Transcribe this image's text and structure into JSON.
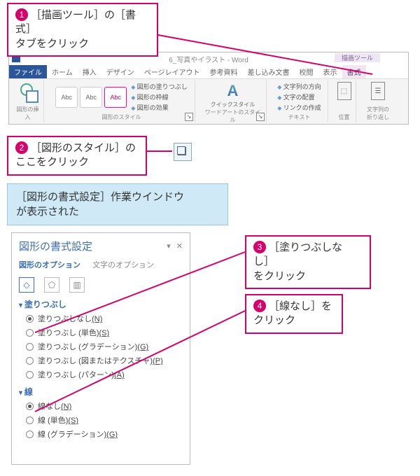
{
  "callouts": {
    "c1": {
      "num": "1",
      "text_a": "［描画ツール］の［書式］",
      "text_b": "タブをクリック"
    },
    "c2": {
      "num": "2",
      "text_a": "［図形のスタイル］の",
      "text_b": "ここをクリック"
    },
    "c3": {
      "num": "3",
      "text_a": "［塗りつぶしなし］",
      "text_b": "をクリック"
    },
    "c4": {
      "num": "4",
      "text_a": "［線なし］を",
      "text_b": "クリック"
    }
  },
  "note": {
    "line1": "［図形の書式設定］作業ウインドウ",
    "line2": "が表示された"
  },
  "ribbon": {
    "doc_title": "6_写真やイラスト - Word",
    "drawing_tools": "描画ツール",
    "tabs": {
      "file": "ファイル",
      "home": "ホーム",
      "insert": "挿入",
      "design": "デザイン",
      "layout": "ページレイアウト",
      "references": "参考資料",
      "mailings": "差し込み文書",
      "review": "校閲",
      "view": "表示",
      "format": "書式"
    },
    "groups": {
      "insert_shapes": "図形の挿入",
      "shape_styles": "図形のスタイル",
      "wordart_styles": "ワードアートのスタイル",
      "text": "テキスト",
      "arrange1": "位置",
      "arrange2": "文字列の折り返し"
    },
    "shape_fill": "図形の塗りつぶし",
    "shape_outline": "図形の枠線",
    "shape_effects": "図形の効果",
    "quick_styles": "クイックスタイル",
    "text_direction": "文字列の方向",
    "align_text": "文字の配置",
    "create_link": "リンクの作成",
    "abc": "Abc"
  },
  "pane": {
    "title": "図形の書式設定",
    "dropdown": "▾",
    "close": "✕",
    "shape_options": "図形のオプション",
    "text_options": "文字のオプション",
    "section_fill": "塗りつぶし",
    "fill": {
      "none": {
        "label": "塗りつぶしなし",
        "accel": "(N)"
      },
      "solid": {
        "label": "塗りつぶし (単色)",
        "accel": "(S)"
      },
      "gradient": {
        "label": "塗りつぶし (グラデーション)",
        "accel": "(G)"
      },
      "picture": {
        "label": "塗りつぶし (図またはテクスチャ)",
        "accel": "(P)"
      },
      "pattern": {
        "label": "塗りつぶし (パターン)",
        "accel": "(A)"
      }
    },
    "section_line": "線",
    "line": {
      "none": {
        "label": "線なし",
        "accel": "(N)"
      },
      "solid": {
        "label": "線 (単色)",
        "accel": "(S)"
      },
      "gradient": {
        "label": "線 (グラデーション)",
        "accel": "(G)"
      }
    }
  }
}
